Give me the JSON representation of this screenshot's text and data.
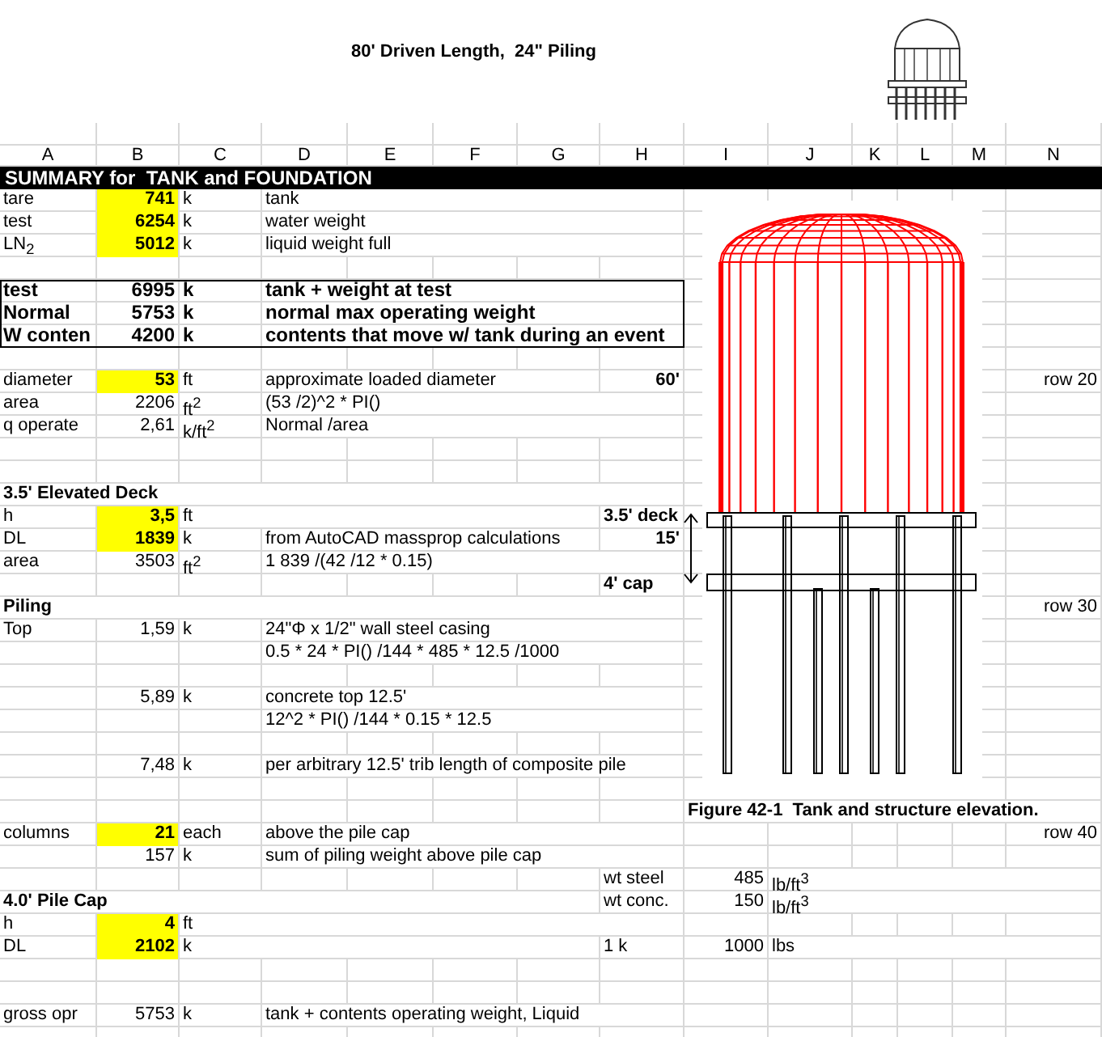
{
  "title": "80' Driven Length,  24\" Piling",
  "column_headers": [
    "A",
    "B",
    "C",
    "D",
    "E",
    "F",
    "G",
    "H",
    "I",
    "J",
    "K",
    "L",
    "M",
    "N"
  ],
  "sheet": [
    {
      "kind": "banner",
      "text": "SUMMARY for  TANK and FOUNDATION"
    },
    {
      "kind": "row",
      "cells": {
        "A": {
          "kind": "label",
          "text": "tare"
        },
        "B": {
          "kind": "input",
          "text": "741"
        },
        "C": {
          "kind": "label",
          "text": "k"
        },
        "D": {
          "kind": "label",
          "text": "tank"
        }
      }
    },
    {
      "kind": "row",
      "cells": {
        "A": {
          "kind": "label",
          "text": "test"
        },
        "B": {
          "kind": "input",
          "text": "6254"
        },
        "C": {
          "kind": "label",
          "text": "k"
        },
        "D": {
          "kind": "label",
          "text": "water weight"
        }
      }
    },
    {
      "kind": "row",
      "cells": {
        "A": {
          "kind": "label",
          "text": "LN$_{2}$"
        },
        "B": {
          "kind": "input",
          "text": "5012"
        },
        "C": {
          "kind": "label",
          "text": "k"
        },
        "D": {
          "kind": "label",
          "text": "liquid weight full"
        }
      }
    },
    {
      "kind": "blank"
    },
    {
      "kind": "totals",
      "rows": [
        {
          "cells": {
            "A": {
              "kind": "bold",
              "text": "test"
            },
            "B": {
              "kind": "bold-value",
              "text": "6995"
            },
            "C": {
              "kind": "bold",
              "text": "k"
            },
            "D": {
              "kind": "bold",
              "text": "tank + weight at test"
            }
          }
        },
        {
          "cells": {
            "A": {
              "kind": "bold",
              "text": "Normal"
            },
            "B": {
              "kind": "bold-value",
              "text": "5753"
            },
            "C": {
              "kind": "bold",
              "text": "k"
            },
            "D": {
              "kind": "bold",
              "text": "normal max operating weight"
            }
          }
        },
        {
          "cells": {
            "A": {
              "kind": "bold",
              "text": "W conten"
            },
            "B": {
              "kind": "bold-value",
              "text": "4200"
            },
            "C": {
              "kind": "bold",
              "text": "k"
            },
            "D": {
              "kind": "bold",
              "text": "contents that move w/ tank during an event"
            }
          }
        }
      ]
    },
    {
      "kind": "blank"
    },
    {
      "kind": "row",
      "cells": {
        "A": {
          "kind": "label",
          "text": "diameter"
        },
        "B": {
          "kind": "input",
          "text": "53"
        },
        "C": {
          "kind": "label",
          "text": "ft"
        },
        "D": {
          "kind": "label",
          "text": "approximate loaded diameter"
        },
        "H": {
          "kind": "bold-value",
          "text": "60'"
        },
        "N": {
          "kind": "value",
          "text": "row 20"
        }
      }
    },
    {
      "kind": "row",
      "cells": {
        "A": {
          "kind": "label",
          "text": "area"
        },
        "B": {
          "kind": "value",
          "text": "2206"
        },
        "C": {
          "kind": "label",
          "text": "ft$^{2}$"
        },
        "D": {
          "kind": "label",
          "text": "(53 /2)^2 * PI()"
        }
      }
    },
    {
      "kind": "row",
      "cells": {
        "A": {
          "kind": "label",
          "text": "q operate"
        },
        "B": {
          "kind": "value",
          "text": "2,61"
        },
        "C": {
          "kind": "label",
          "text": "k/ft$^{2}$"
        },
        "D": {
          "kind": "label",
          "text": "Normal /area"
        }
      }
    },
    {
      "kind": "blank"
    },
    {
      "kind": "blank"
    },
    {
      "kind": "row",
      "cells": {
        "A": {
          "kind": "bold",
          "text": "3.5' Elevated Deck"
        }
      }
    },
    {
      "kind": "row",
      "cells": {
        "A": {
          "kind": "label",
          "text": "h"
        },
        "B": {
          "kind": "input",
          "text": "3,5"
        },
        "C": {
          "kind": "label",
          "text": "ft"
        },
        "H": {
          "kind": "bold",
          "text": "3.5' deck"
        }
      }
    },
    {
      "kind": "row",
      "cells": {
        "A": {
          "kind": "label",
          "text": "DL"
        },
        "B": {
          "kind": "input",
          "text": "1839"
        },
        "C": {
          "kind": "label",
          "text": "k"
        },
        "D": {
          "kind": "label",
          "text": "from AutoCAD massprop calculations"
        },
        "H": {
          "kind": "bold-value",
          "text": "15'"
        }
      }
    },
    {
      "kind": "row",
      "cells": {
        "A": {
          "kind": "label",
          "text": "area"
        },
        "B": {
          "kind": "value",
          "text": "3503"
        },
        "C": {
          "kind": "label",
          "text": "ft$^{2}$"
        },
        "D": {
          "kind": "label",
          "text": "1 839 /(42 /12 * 0.15)"
        }
      }
    },
    {
      "kind": "row",
      "cells": {
        "H": {
          "kind": "bold",
          "text": "4' cap"
        }
      }
    },
    {
      "kind": "row",
      "cells": {
        "A": {
          "kind": "bold",
          "text": "Piling"
        },
        "N": {
          "kind": "value",
          "text": "row 30"
        }
      }
    },
    {
      "kind": "row",
      "cells": {
        "A": {
          "kind": "label",
          "text": "Top"
        },
        "B": {
          "kind": "value",
          "text": "1,59"
        },
        "C": {
          "kind": "label",
          "text": "k"
        },
        "D": {
          "kind": "label",
          "text": "24\"Φ x 1/2\" wall steel casing"
        }
      }
    },
    {
      "kind": "row",
      "cells": {
        "D": {
          "kind": "label",
          "text": "0.5 * 24 * PI() /144 * 485 * 12.5 /1000"
        }
      }
    },
    {
      "kind": "blank"
    },
    {
      "kind": "row",
      "cells": {
        "B": {
          "kind": "value",
          "text": "5,89"
        },
        "C": {
          "kind": "label",
          "text": "k"
        },
        "D": {
          "kind": "label",
          "text": "concrete top 12.5'"
        }
      }
    },
    {
      "kind": "row",
      "cells": {
        "D": {
          "kind": "label",
          "text": "12^2 * PI() /144 * 0.15 * 12.5"
        }
      }
    },
    {
      "kind": "blank"
    },
    {
      "kind": "row",
      "cells": {
        "B": {
          "kind": "value",
          "text": "7,48"
        },
        "C": {
          "kind": "label",
          "text": "k"
        },
        "D": {
          "kind": "label",
          "text": "per arbitrary 12.5' trib length of composite pile"
        }
      }
    },
    {
      "kind": "blank"
    },
    {
      "kind": "row",
      "cells": {
        "I": {
          "kind": "bold",
          "text": "Figure 42-1  Tank and structure elevation."
        }
      }
    },
    {
      "kind": "row",
      "cells": {
        "A": {
          "kind": "label",
          "text": "columns"
        },
        "B": {
          "kind": "input",
          "text": "21"
        },
        "C": {
          "kind": "label",
          "text": "each"
        },
        "D": {
          "kind": "label",
          "text": "above the pile cap"
        },
        "N": {
          "kind": "value",
          "text": "row 40"
        }
      }
    },
    {
      "kind": "row",
      "cells": {
        "B": {
          "kind": "value",
          "text": "157"
        },
        "C": {
          "kind": "label",
          "text": "k"
        },
        "D": {
          "kind": "label",
          "text": "sum of piling weight above pile cap"
        }
      }
    },
    {
      "kind": "row",
      "cells": {
        "H": {
          "kind": "label",
          "text": "wt steel"
        },
        "I": {
          "kind": "value",
          "text": "485"
        },
        "J": {
          "kind": "label",
          "text": "lb/ft$^{3}$"
        }
      }
    },
    {
      "kind": "row",
      "cells": {
        "A": {
          "kind": "bold",
          "text": "4.0' Pile Cap"
        },
        "H": {
          "kind": "label",
          "text": "wt conc."
        },
        "I": {
          "kind": "value",
          "text": "150"
        },
        "J": {
          "kind": "label",
          "text": "lb/ft$^{3}$"
        }
      }
    },
    {
      "kind": "row",
      "cells": {
        "A": {
          "kind": "label",
          "text": "h"
        },
        "B": {
          "kind": "input",
          "text": "4"
        },
        "C": {
          "kind": "label",
          "text": "ft"
        }
      }
    },
    {
      "kind": "row",
      "cells": {
        "A": {
          "kind": "label",
          "text": "DL"
        },
        "B": {
          "kind": "input",
          "text": "2102"
        },
        "C": {
          "kind": "label",
          "text": "k"
        },
        "H": {
          "kind": "label",
          "text": "1 k"
        },
        "I": {
          "kind": "value",
          "text": "1000"
        },
        "J": {
          "kind": "label",
          "text": "lbs"
        }
      }
    },
    {
      "kind": "blank"
    },
    {
      "kind": "blank"
    },
    {
      "kind": "row",
      "cells": {
        "A": {
          "kind": "label",
          "text": "gross opr"
        },
        "B": {
          "kind": "value",
          "text": "5753"
        },
        "C": {
          "kind": "label",
          "text": "k"
        },
        "D": {
          "kind": "label",
          "text": "tank + contents operating weight, Liquid"
        }
      }
    }
  ]
}
